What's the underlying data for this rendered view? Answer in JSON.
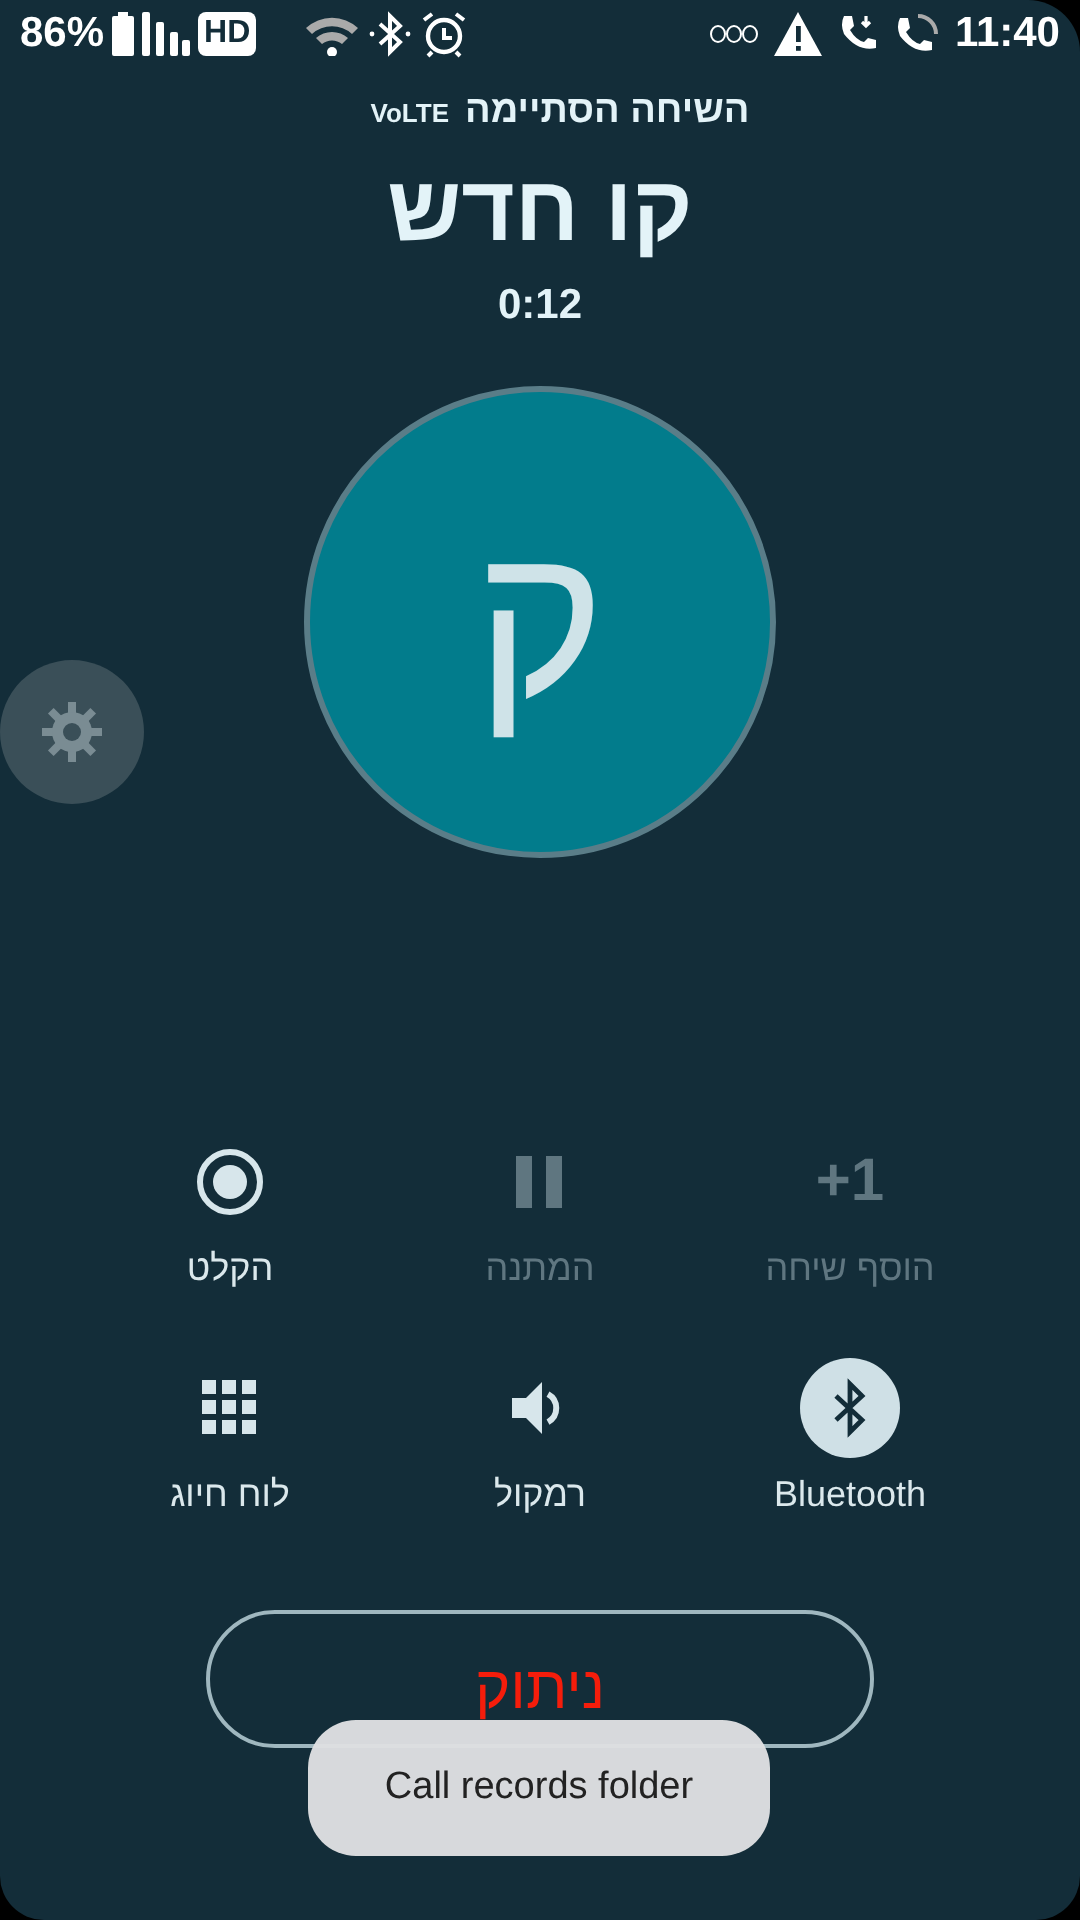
{
  "status_bar": {
    "battery": "86%",
    "network_badge": "HD",
    "time": "11:40"
  },
  "call": {
    "status": "השיחה הסתיימה",
    "network": "VoLTE",
    "name": "קו חדש",
    "duration": "0:12",
    "avatar_letter": "ק"
  },
  "controls": [
    {
      "kind": "add",
      "label": "הוסף שיחה",
      "icon_text": "+1",
      "disabled": true,
      "selected": false
    },
    {
      "kind": "hold",
      "label": "המתנה",
      "disabled": true,
      "selected": false
    },
    {
      "kind": "record",
      "label": "הקלט",
      "disabled": false,
      "selected": false
    },
    {
      "kind": "bluetooth",
      "label": "Bluetooth",
      "disabled": false,
      "selected": true
    },
    {
      "kind": "speaker",
      "label": "רמקול",
      "disabled": false,
      "selected": false
    },
    {
      "kind": "keypad",
      "label": "לוח חיוג",
      "disabled": false,
      "selected": false
    }
  ],
  "end_button": {
    "label": "ניתוק"
  },
  "toast": {
    "text": "Call records folder"
  }
}
